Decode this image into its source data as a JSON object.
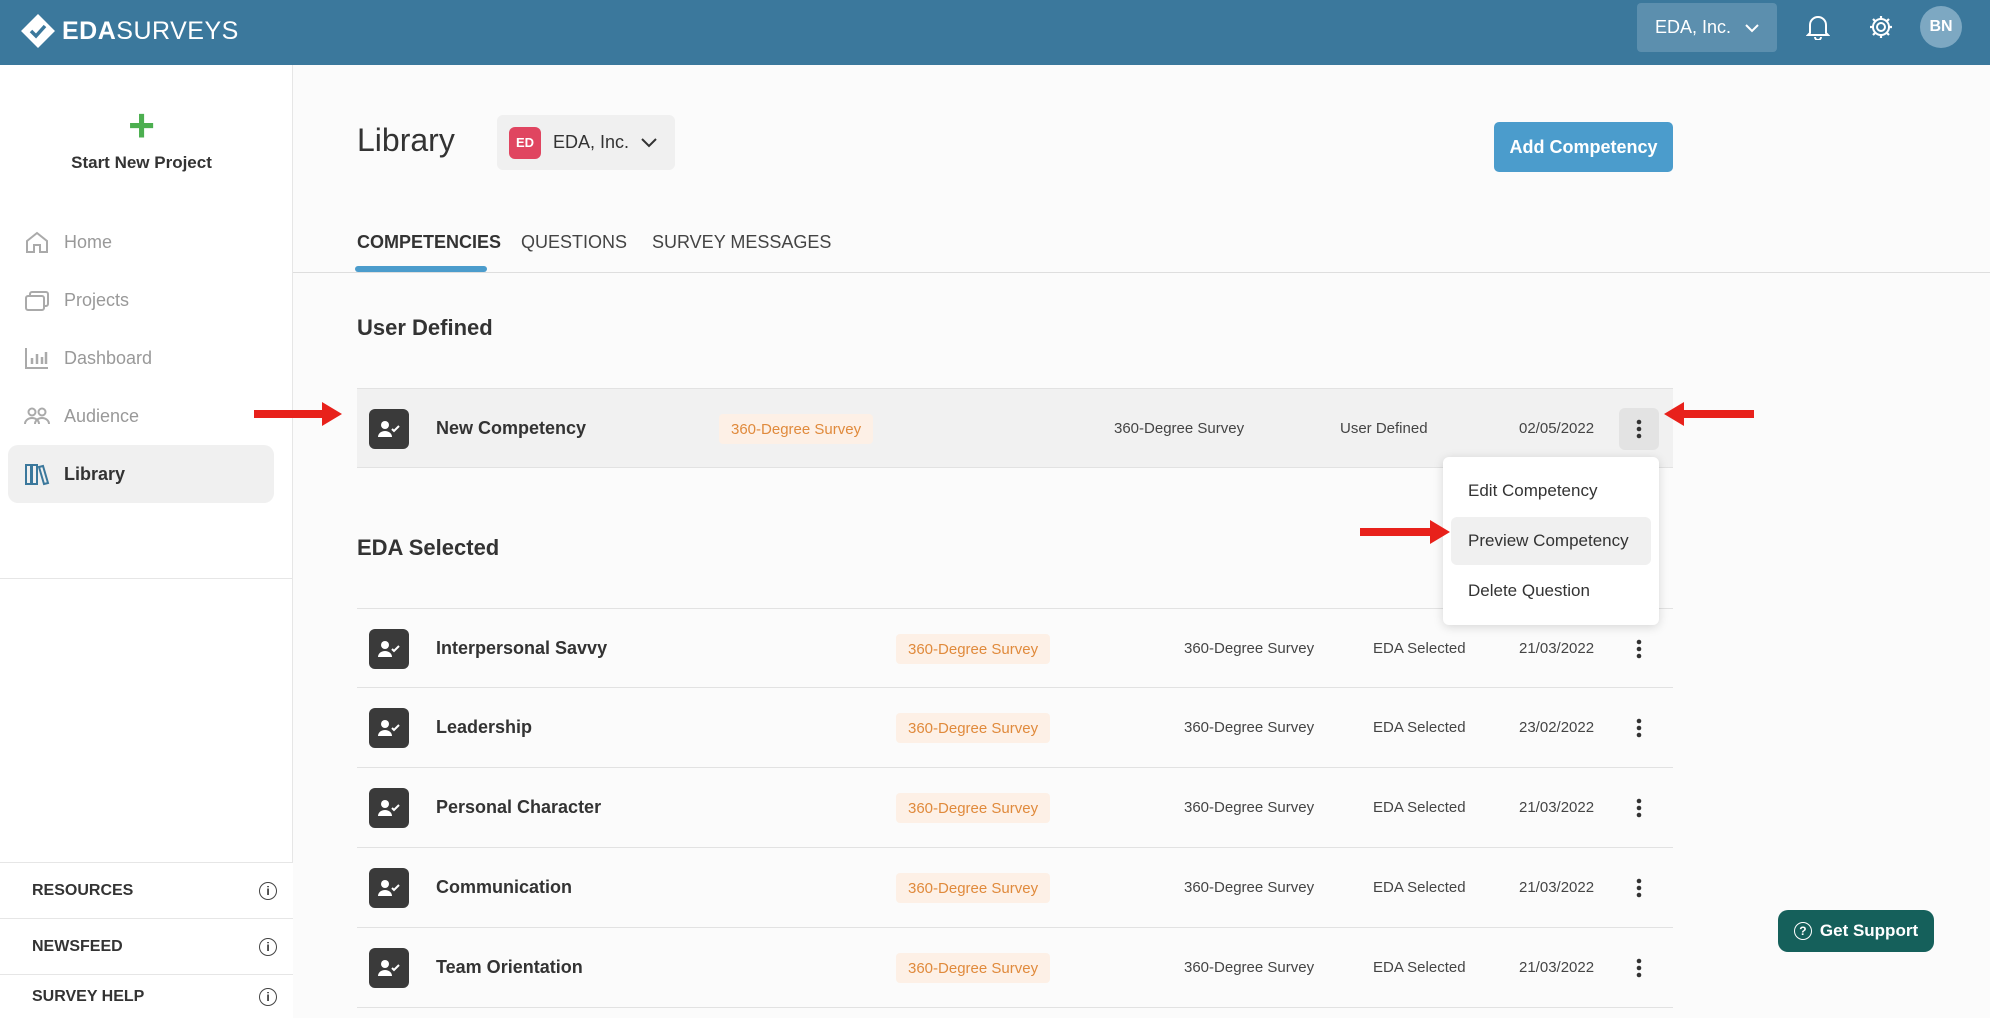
{
  "header": {
    "brand_bold": "EDA",
    "brand_rest": "SURVEYS",
    "org_select": "EDA, Inc.",
    "avatar_initials": "BN"
  },
  "sidebar": {
    "new_project": "Start New Project",
    "items": [
      {
        "label": "Home",
        "icon": "home-icon"
      },
      {
        "label": "Projects",
        "icon": "folders-icon"
      },
      {
        "label": "Dashboard",
        "icon": "bar-chart-icon"
      },
      {
        "label": "Audience",
        "icon": "people-icon"
      },
      {
        "label": "Library",
        "icon": "books-icon",
        "active": true
      }
    ],
    "links": [
      {
        "label": "RESOURCES"
      },
      {
        "label": "NEWSFEED"
      },
      {
        "label": "SURVEY HELP"
      }
    ]
  },
  "main": {
    "title": "Library",
    "org_badge": "ED",
    "org_name": "EDA, Inc.",
    "add_button": "Add Competency",
    "tabs": [
      {
        "label": "COMPETENCIES",
        "active": true
      },
      {
        "label": "QUESTIONS"
      },
      {
        "label": "SURVEY MESSAGES"
      }
    ],
    "user_defined_title": "User Defined",
    "user_defined_rows": [
      {
        "name": "New Competency",
        "tag": "360-Degree Survey",
        "survey": "360-Degree Survey",
        "type": "User Defined",
        "date": "02/05/2022"
      }
    ],
    "context_menu": [
      {
        "label": "Edit Competency"
      },
      {
        "label": "Preview Competency",
        "hover": true
      },
      {
        "label": "Delete Question"
      }
    ],
    "eda_selected_title": "EDA Selected",
    "eda_selected_rows": [
      {
        "name": "Interpersonal Savvy",
        "tag": "360-Degree Survey",
        "survey": "360-Degree Survey",
        "type": "EDA Selected",
        "date": "21/03/2022"
      },
      {
        "name": "Leadership",
        "tag": "360-Degree Survey",
        "survey": "360-Degree Survey",
        "type": "EDA Selected",
        "date": "23/02/2022"
      },
      {
        "name": "Personal Character",
        "tag": "360-Degree Survey",
        "survey": "360-Degree Survey",
        "type": "EDA Selected",
        "date": "21/03/2022"
      },
      {
        "name": "Communication",
        "tag": "360-Degree Survey",
        "survey": "360-Degree Survey",
        "type": "EDA Selected",
        "date": "21/03/2022"
      },
      {
        "name": "Team Orientation",
        "tag": "360-Degree Survey",
        "survey": "360-Degree Survey",
        "type": "EDA Selected",
        "date": "21/03/2022"
      }
    ]
  },
  "support_button": "Get Support",
  "colors": {
    "header": "#3b789c",
    "accent": "#4b9ccc",
    "tag_text": "#e08a3c",
    "annotation_arrow": "#e8211b",
    "support": "#15605b"
  }
}
